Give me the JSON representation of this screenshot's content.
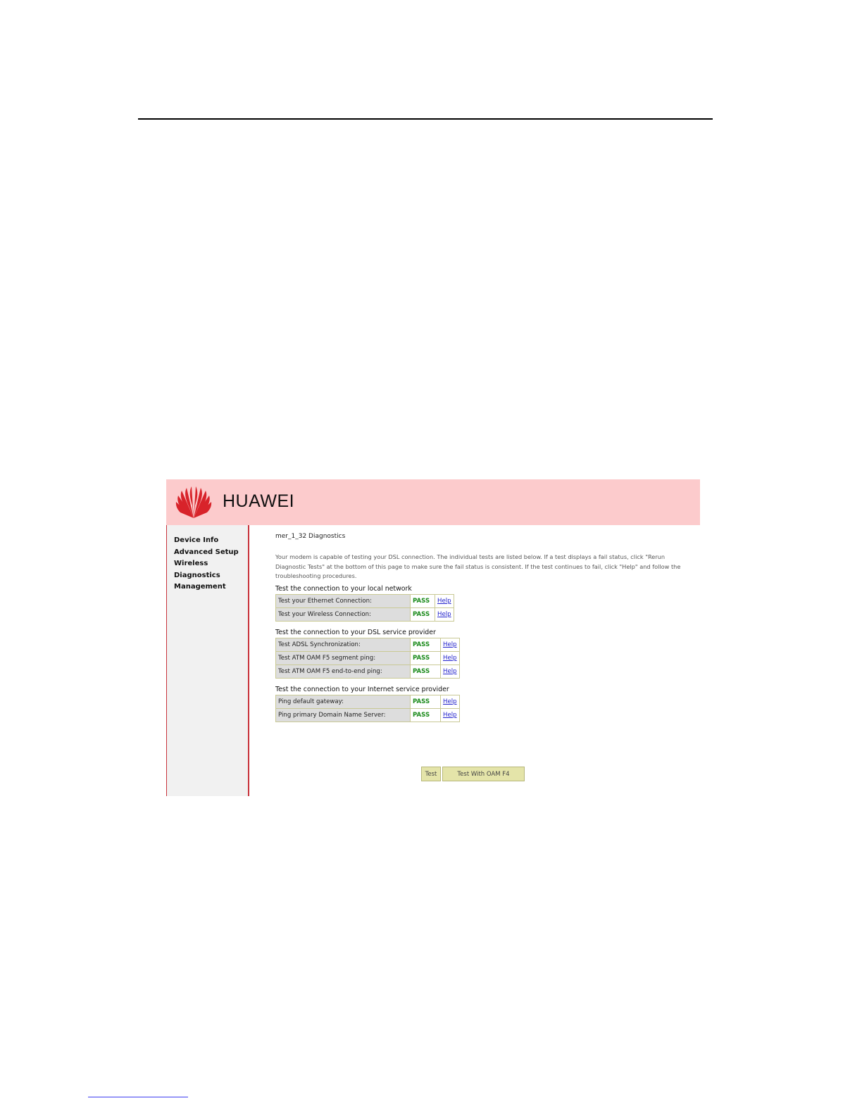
{
  "brand": {
    "name": "HUAWEI"
  },
  "sidebar": {
    "items": [
      {
        "label": "Device Info"
      },
      {
        "label": "Advanced Setup"
      },
      {
        "label": "Wireless"
      },
      {
        "label": "Diagnostics"
      },
      {
        "label": "Management"
      }
    ]
  },
  "main": {
    "title": "mer_1_32 Diagnostics",
    "intro": "Your modem is capable of testing your DSL connection. The individual tests are listed below. If a test displays a fail status, click \"Rerun Diagnostic Tests\" at the bottom of this page to make sure the fail status is consistent. If the test continues to fail, click \"Help\" and follow the troubleshooting procedures.",
    "sections": [
      {
        "title": "Test the connection to your local network",
        "rows": [
          {
            "label": "Test your Ethernet Connection:",
            "status": "PASS",
            "help": "Help"
          },
          {
            "label": "Test your Wireless Connection:",
            "status": "PASS",
            "help": "Help"
          }
        ]
      },
      {
        "title": "Test the connection to your DSL service provider",
        "rows": [
          {
            "label": "Test ADSL Synchronization:",
            "status": "PASS",
            "help": "Help"
          },
          {
            "label": "Test ATM OAM F5 segment ping:",
            "status": "PASS",
            "help": "Help"
          },
          {
            "label": "Test ATM OAM F5 end-to-end ping:",
            "status": "PASS",
            "help": "Help"
          }
        ]
      },
      {
        "title": "Test the connection to your Internet service provider",
        "rows": [
          {
            "label": "Ping default gateway:",
            "status": "PASS",
            "help": "Help"
          },
          {
            "label": "Ping primary Domain Name Server:",
            "status": "PASS",
            "help": "Help"
          }
        ]
      }
    ],
    "buttons": {
      "test": "Test",
      "test_oam_f4": "Test With OAM F4"
    }
  },
  "colors": {
    "header_bg": "#fccbcc",
    "logo_red": "#d8232a",
    "pass_green": "#1b8b1b",
    "link_blue": "#2222cc",
    "button_bg": "#e4e4a9"
  }
}
